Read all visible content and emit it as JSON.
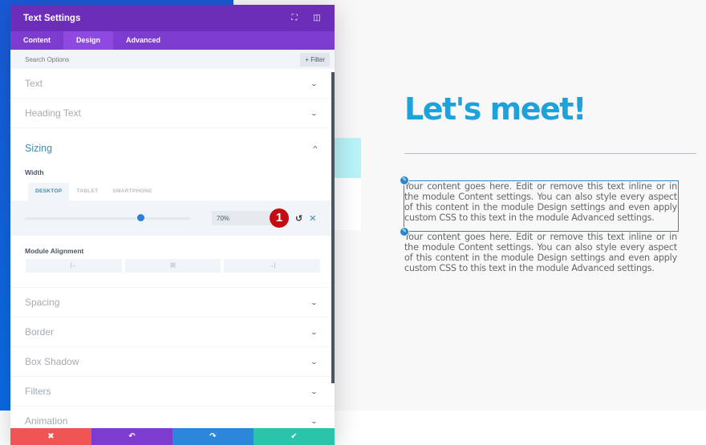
{
  "canvas": {
    "heading": "Let's meet!",
    "paragraph_1": "Your content goes here. Edit or remove this text inline or in the module Content settings. You can also style every aspect of this content in the module Design settings and even apply custom CSS to this text in the module Advanced settings.",
    "paragraph_2": "Your content goes here. Edit or remove this text inline or in the module Content settings. You can also style every aspect of this content in the module Design settings and even apply custom CSS to this text in the module Advanced settings.",
    "edit_icon": "✎"
  },
  "modal": {
    "title": "Text Settings",
    "header_icons": {
      "focus": "⛶",
      "split": "◫"
    },
    "tabs": [
      {
        "label": "Content",
        "active": false
      },
      {
        "label": "Design",
        "active": true
      },
      {
        "label": "Advanced",
        "active": false
      }
    ],
    "search": {
      "placeholder": "Search Options",
      "filter_label": "+ Filter"
    },
    "sections_before": [
      {
        "label": "Text"
      },
      {
        "label": "Heading Text"
      }
    ],
    "sizing": {
      "label": "Sizing",
      "width_label": "Width",
      "device_tabs": [
        {
          "label": "DESKTOP",
          "active": true
        },
        {
          "label": "TABLET",
          "active": false
        },
        {
          "label": "SMARTPHONE",
          "active": false
        }
      ],
      "width_value": "70%",
      "slider_percent": 70,
      "step_badge": "1",
      "reset_icon": "↺",
      "clear_icon": "✕",
      "alignment_label": "Module Alignment",
      "alignment_options": [
        {
          "name": "left",
          "glyph": "|←"
        },
        {
          "name": "center",
          "glyph": "|‖|"
        },
        {
          "name": "right",
          "glyph": "→|"
        }
      ]
    },
    "sections_after": [
      {
        "label": "Spacing"
      },
      {
        "label": "Border"
      },
      {
        "label": "Box Shadow"
      },
      {
        "label": "Filters"
      },
      {
        "label": "Animation"
      }
    ],
    "chevron_down": "⌄",
    "chevron_up": "^",
    "footer": {
      "cancel": "✖",
      "undo": "↶",
      "redo": "↷",
      "save": "✔"
    }
  }
}
